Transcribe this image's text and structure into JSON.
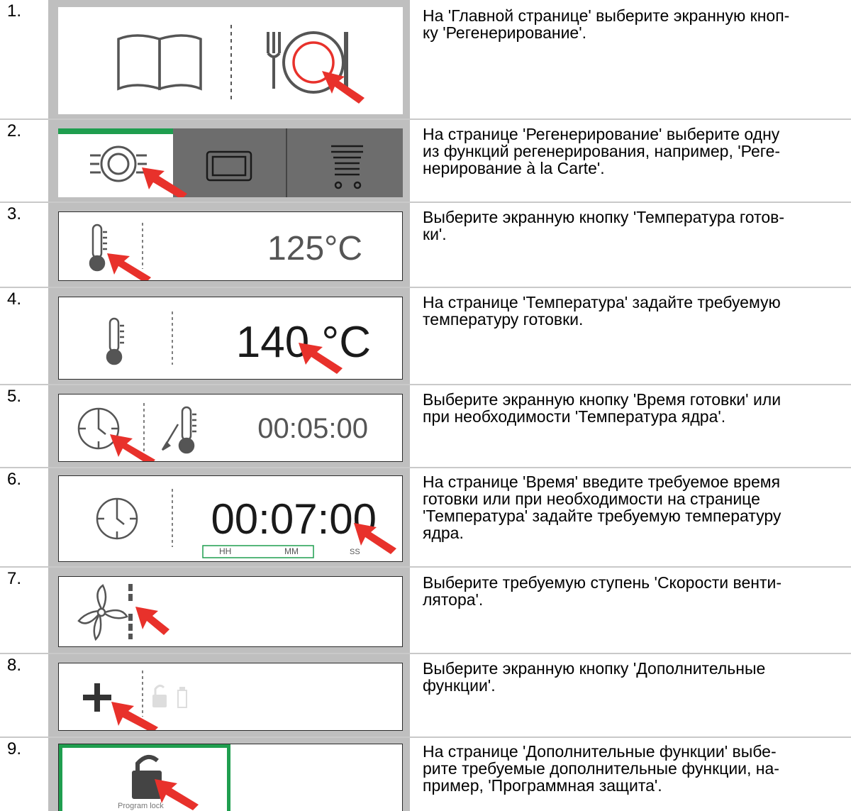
{
  "steps": [
    {
      "num": "1.",
      "text": "На 'Главной странице' выберите экранную кноп-\nку 'Регенерирование'."
    },
    {
      "num": "2.",
      "text": "На странице 'Регенерирование' выберите одну\nиз функций регенерирования, например, 'Реге-\nнерирование à la Carte'."
    },
    {
      "num": "3.",
      "text": "Выберите экранную кнопку 'Температура готов-\nки'."
    },
    {
      "num": "4.",
      "text": "На странице 'Температура' задайте требуемую\nтемпературу готовки."
    },
    {
      "num": "5.",
      "text": "Выберите экранную кнопку 'Время готовки' или\nпри необходимости 'Температура ядра'."
    },
    {
      "num": "6.",
      "text": "На странице 'Время' введите требуемое время\nготовки или при необходимости на странице\n'Температура' задайте требуемую температуру\nядра."
    },
    {
      "num": "7.",
      "text": "Выберите требуемую ступень 'Скорости венти-\nлятора'."
    },
    {
      "num": "8.",
      "text": "Выберите экранную кнопку 'Дополнительные\nфункции'."
    },
    {
      "num": "9.",
      "text": "На странице 'Дополнительные функции' выбе-\nрите требуемые дополнительные функции, на-\nпример, 'Программная защита'."
    }
  ],
  "screens": {
    "step3_temp": "125°C",
    "step4_temp": "140 °C",
    "step5_time": "00:05:00",
    "step6_time": "00:07:00",
    "step6_hh": "HH",
    "step6_mm": "MM",
    "step6_ss": "SS",
    "step9_label": "Program lock"
  },
  "colors": {
    "arrow": "#e8312b",
    "accent_green": "#1f9e4f",
    "ring_red": "#e8312b",
    "icon_gray": "#555555",
    "frame_gray": "#bfbfbf"
  }
}
